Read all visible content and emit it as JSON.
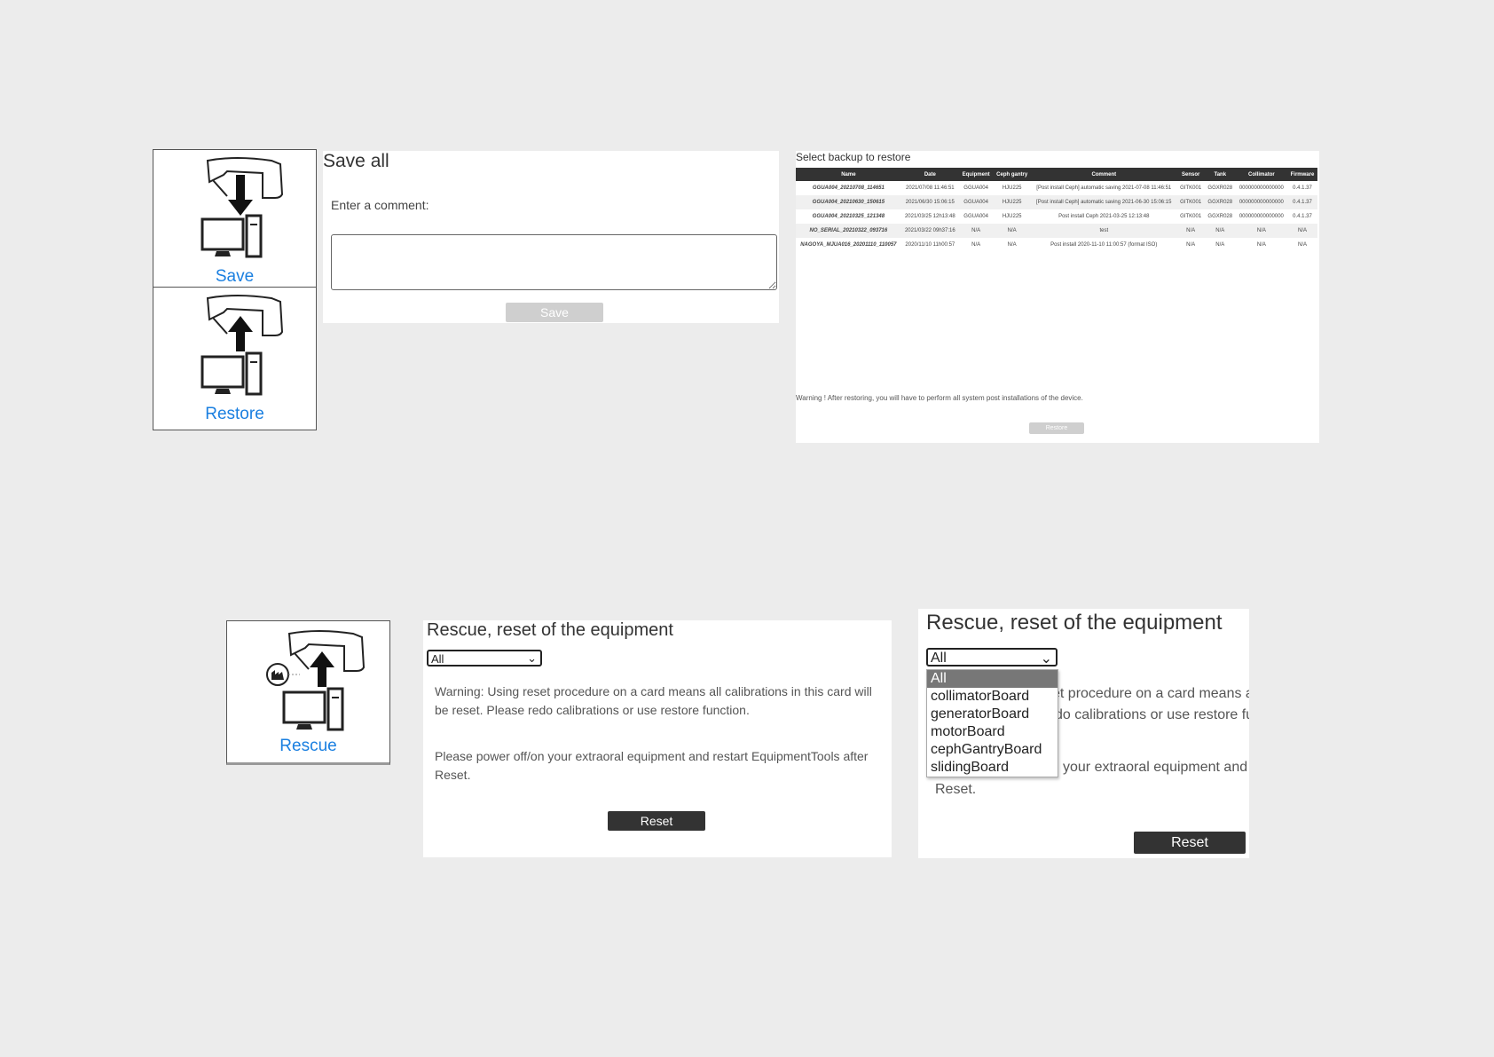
{
  "save_tile": {
    "label": "Save",
    "icon": "save-to-computer-icon"
  },
  "restore_tile": {
    "label": "Restore",
    "icon": "restore-from-computer-icon"
  },
  "rescue_tile": {
    "label": "Rescue",
    "icon": "factory-rescue-icon"
  },
  "save_panel": {
    "title": "Save all",
    "comment_label": "Enter a comment:",
    "comment_value": "",
    "button": "Save"
  },
  "restore_panel": {
    "title": "Select backup to restore",
    "columns": [
      "Name",
      "Date",
      "Equipment",
      "Ceph gantry",
      "Comment",
      "Sensor",
      "Tank",
      "Collimator",
      "Firmware"
    ],
    "rows": [
      [
        "GGUA004_20210708_114651",
        "2021/07/08 11:46:51",
        "GGUA004",
        "HJU225",
        "[Post install Ceph] automatic saving 2021-07-08 11:46:51",
        "GITK001",
        "GGXR028",
        "000000000000000",
        "0.4.1.37"
      ],
      [
        "GGUA004_20210630_150615",
        "2021/06/30 15:06:15",
        "GGUA004",
        "HJU225",
        "[Post install Ceph] automatic saving 2021-06-30 15:06:15",
        "GITK001",
        "GGXR028",
        "000000000000000",
        "0.4.1.37"
      ],
      [
        "GGUA004_20210325_121348",
        "2021/03/25 12h13:48",
        "GGUA004",
        "HJU225",
        "Post install Ceph 2021-03-25 12:13:48",
        "GITK001",
        "GGXR028",
        "000000000000000",
        "0.4.1.37"
      ],
      [
        "NO_SERIAL_20210322_093716",
        "2021/03/22 09h37:16",
        "N/A",
        "N/A",
        "test",
        "N/A",
        "N/A",
        "N/A",
        "N/A"
      ],
      [
        "NAGOYA_MJUA016_20201110_110057",
        "2020/11/10 11h00:57",
        "N/A",
        "N/A",
        "Post install 2020-11-10 11:00:57 (format ISO)",
        "N/A",
        "N/A",
        "N/A",
        "N/A"
      ]
    ],
    "warning": "Warning ! After restoring, you will have to perform all system post installations of the device.",
    "button": "Restore"
  },
  "rescue_panel_1": {
    "title": "Rescue, reset of the equipment",
    "select_value": "All",
    "warning": "Warning: Using reset procedure on a card means all calibrations in this card will be reset. Please redo calibrations or use restore function.",
    "power_note": "Please power off/on your extraoral equipment and restart EquipmentTools after Reset.",
    "button": "Reset"
  },
  "rescue_panel_2": {
    "title": "Rescue, reset of the equipment",
    "select_value": "All",
    "options": [
      "All",
      "collimatorBoard",
      "generatorBoard",
      "motorBoard",
      "cephGantryBoard",
      "slidingBoard"
    ],
    "warning_partial_1": "et procedure on a card means a",
    "warning_partial_2": "do calibrations or use restore fu",
    "power_partial": "your extraoral equipment and",
    "power_partial_2": "Reset.",
    "button": "Reset"
  }
}
